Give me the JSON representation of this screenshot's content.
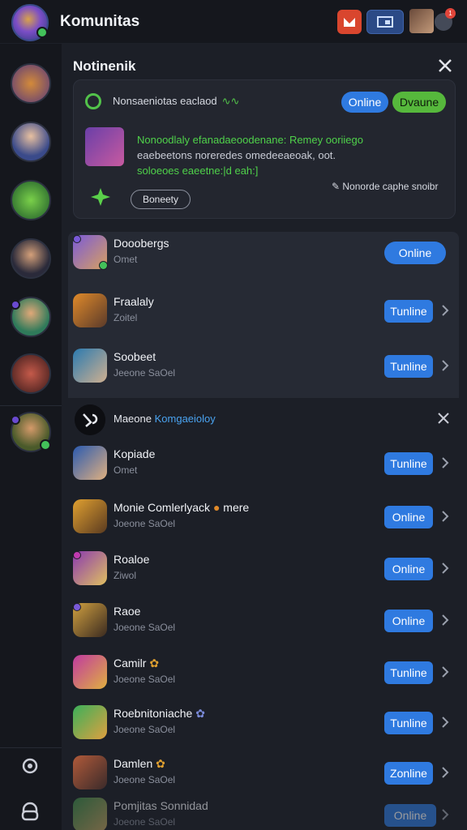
{
  "header": {
    "title": "Komunitas",
    "badge_count": "1"
  },
  "notification": {
    "title": "Notinenik",
    "head": "Nonsaeniotas eaclaod",
    "pills": [
      "Online",
      "Dvaune"
    ],
    "body_lines": [
      "Nonoodlaly efanadaeoodenane: Remey ooriiego",
      "eaebeetons noreredes omedeeaeoak, oot.",
      "soloeoes eaeetne:|d eah:]"
    ],
    "button": "Boneety",
    "note": "Nonorde caphe snoibr"
  },
  "contacts": [
    {
      "name": "Dooobergs",
      "sub": "Omet",
      "action": "Online"
    },
    {
      "name": "Fraalaly",
      "sub": "Zoitel",
      "action": "Tunline"
    },
    {
      "name": "Soobeet",
      "sub": "Jeeone SaOel",
      "action": "Tunline"
    }
  ],
  "macro": {
    "prefix": "Maeone",
    "link": "Komgaeioloy"
  },
  "contacts2": [
    {
      "name": "Kopiade",
      "sub": "Omet",
      "action": "Tunline"
    },
    {
      "name": "Monie Comlerlyack",
      "suffix": "mere",
      "sub": "Joeone SaOel",
      "action": "Online"
    },
    {
      "name": "Roaloe",
      "sub": "Ziwol",
      "action": "Online"
    },
    {
      "name": "Raoe",
      "sub": "Joeone SaOel",
      "action": "Online"
    },
    {
      "name": "Camilr",
      "sub": "Joeone SaOel",
      "action": "Tunline"
    },
    {
      "name": "Roebnitoniache",
      "sub": "Joeone SaOel",
      "action": "Tunline"
    },
    {
      "name": "Damlen",
      "sub": "Joeone SaOel",
      "action": "Zonline"
    }
  ],
  "bottom": {
    "name": "Pomjitas Sonnidad",
    "sub": "Joeone SaOel",
    "action": "Online"
  },
  "colors": {
    "accent": "#2f7ae0",
    "online_green": "#43c25a",
    "background": "#1c1f27"
  }
}
